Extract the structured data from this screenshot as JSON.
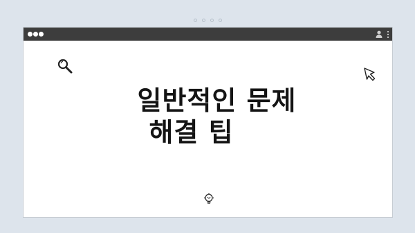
{
  "slide": {
    "title_line1": "일반적인 문제",
    "title_line2": "해결 팁"
  },
  "colors": {
    "background": "#dde4ec",
    "titlebar": "#3d3d3d",
    "text": "#141414"
  },
  "icons": [
    "search-icon",
    "cursor-icon",
    "lightbulb-icon",
    "user-icon",
    "kebab-menu-icon"
  ]
}
